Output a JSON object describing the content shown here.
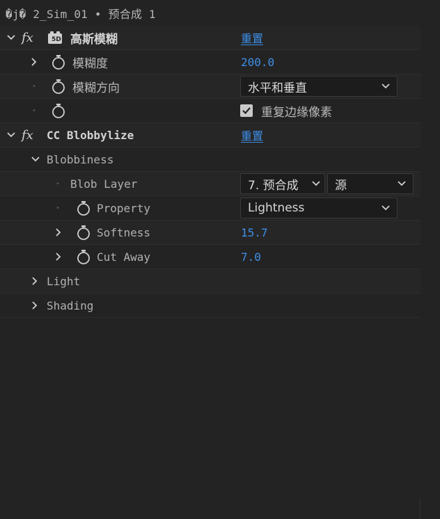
{
  "title": "�j� 2_Sim_01 • 预合成 1",
  "effects": {
    "gaussian": {
      "name": "高斯模糊",
      "reset": "重置",
      "blurriness_label": "模糊度",
      "blurriness_value": "200.0",
      "direction_label": "模糊方向",
      "direction_value": "水平和垂直",
      "repeat_edge_label": "重复边缘像素",
      "repeat_edge_checked": true
    },
    "blobbylize": {
      "name": "CC Blobbylize",
      "reset": "重置",
      "blobbiness_label": "Blobbiness",
      "blob_layer_label": "Blob Layer",
      "blob_layer_value": "7. 预合成",
      "blob_layer_source": "源",
      "property_label": "Property",
      "property_value": "Lightness",
      "softness_label": "Softness",
      "softness_value": "15.7",
      "cutaway_label": "Cut Away",
      "cutaway_value": "7.0",
      "light_label": "Light",
      "shading_label": "Shading"
    }
  },
  "colors": {
    "accent": "#3e8fe8",
    "background": "#232323",
    "text": "#a7a7a7"
  }
}
